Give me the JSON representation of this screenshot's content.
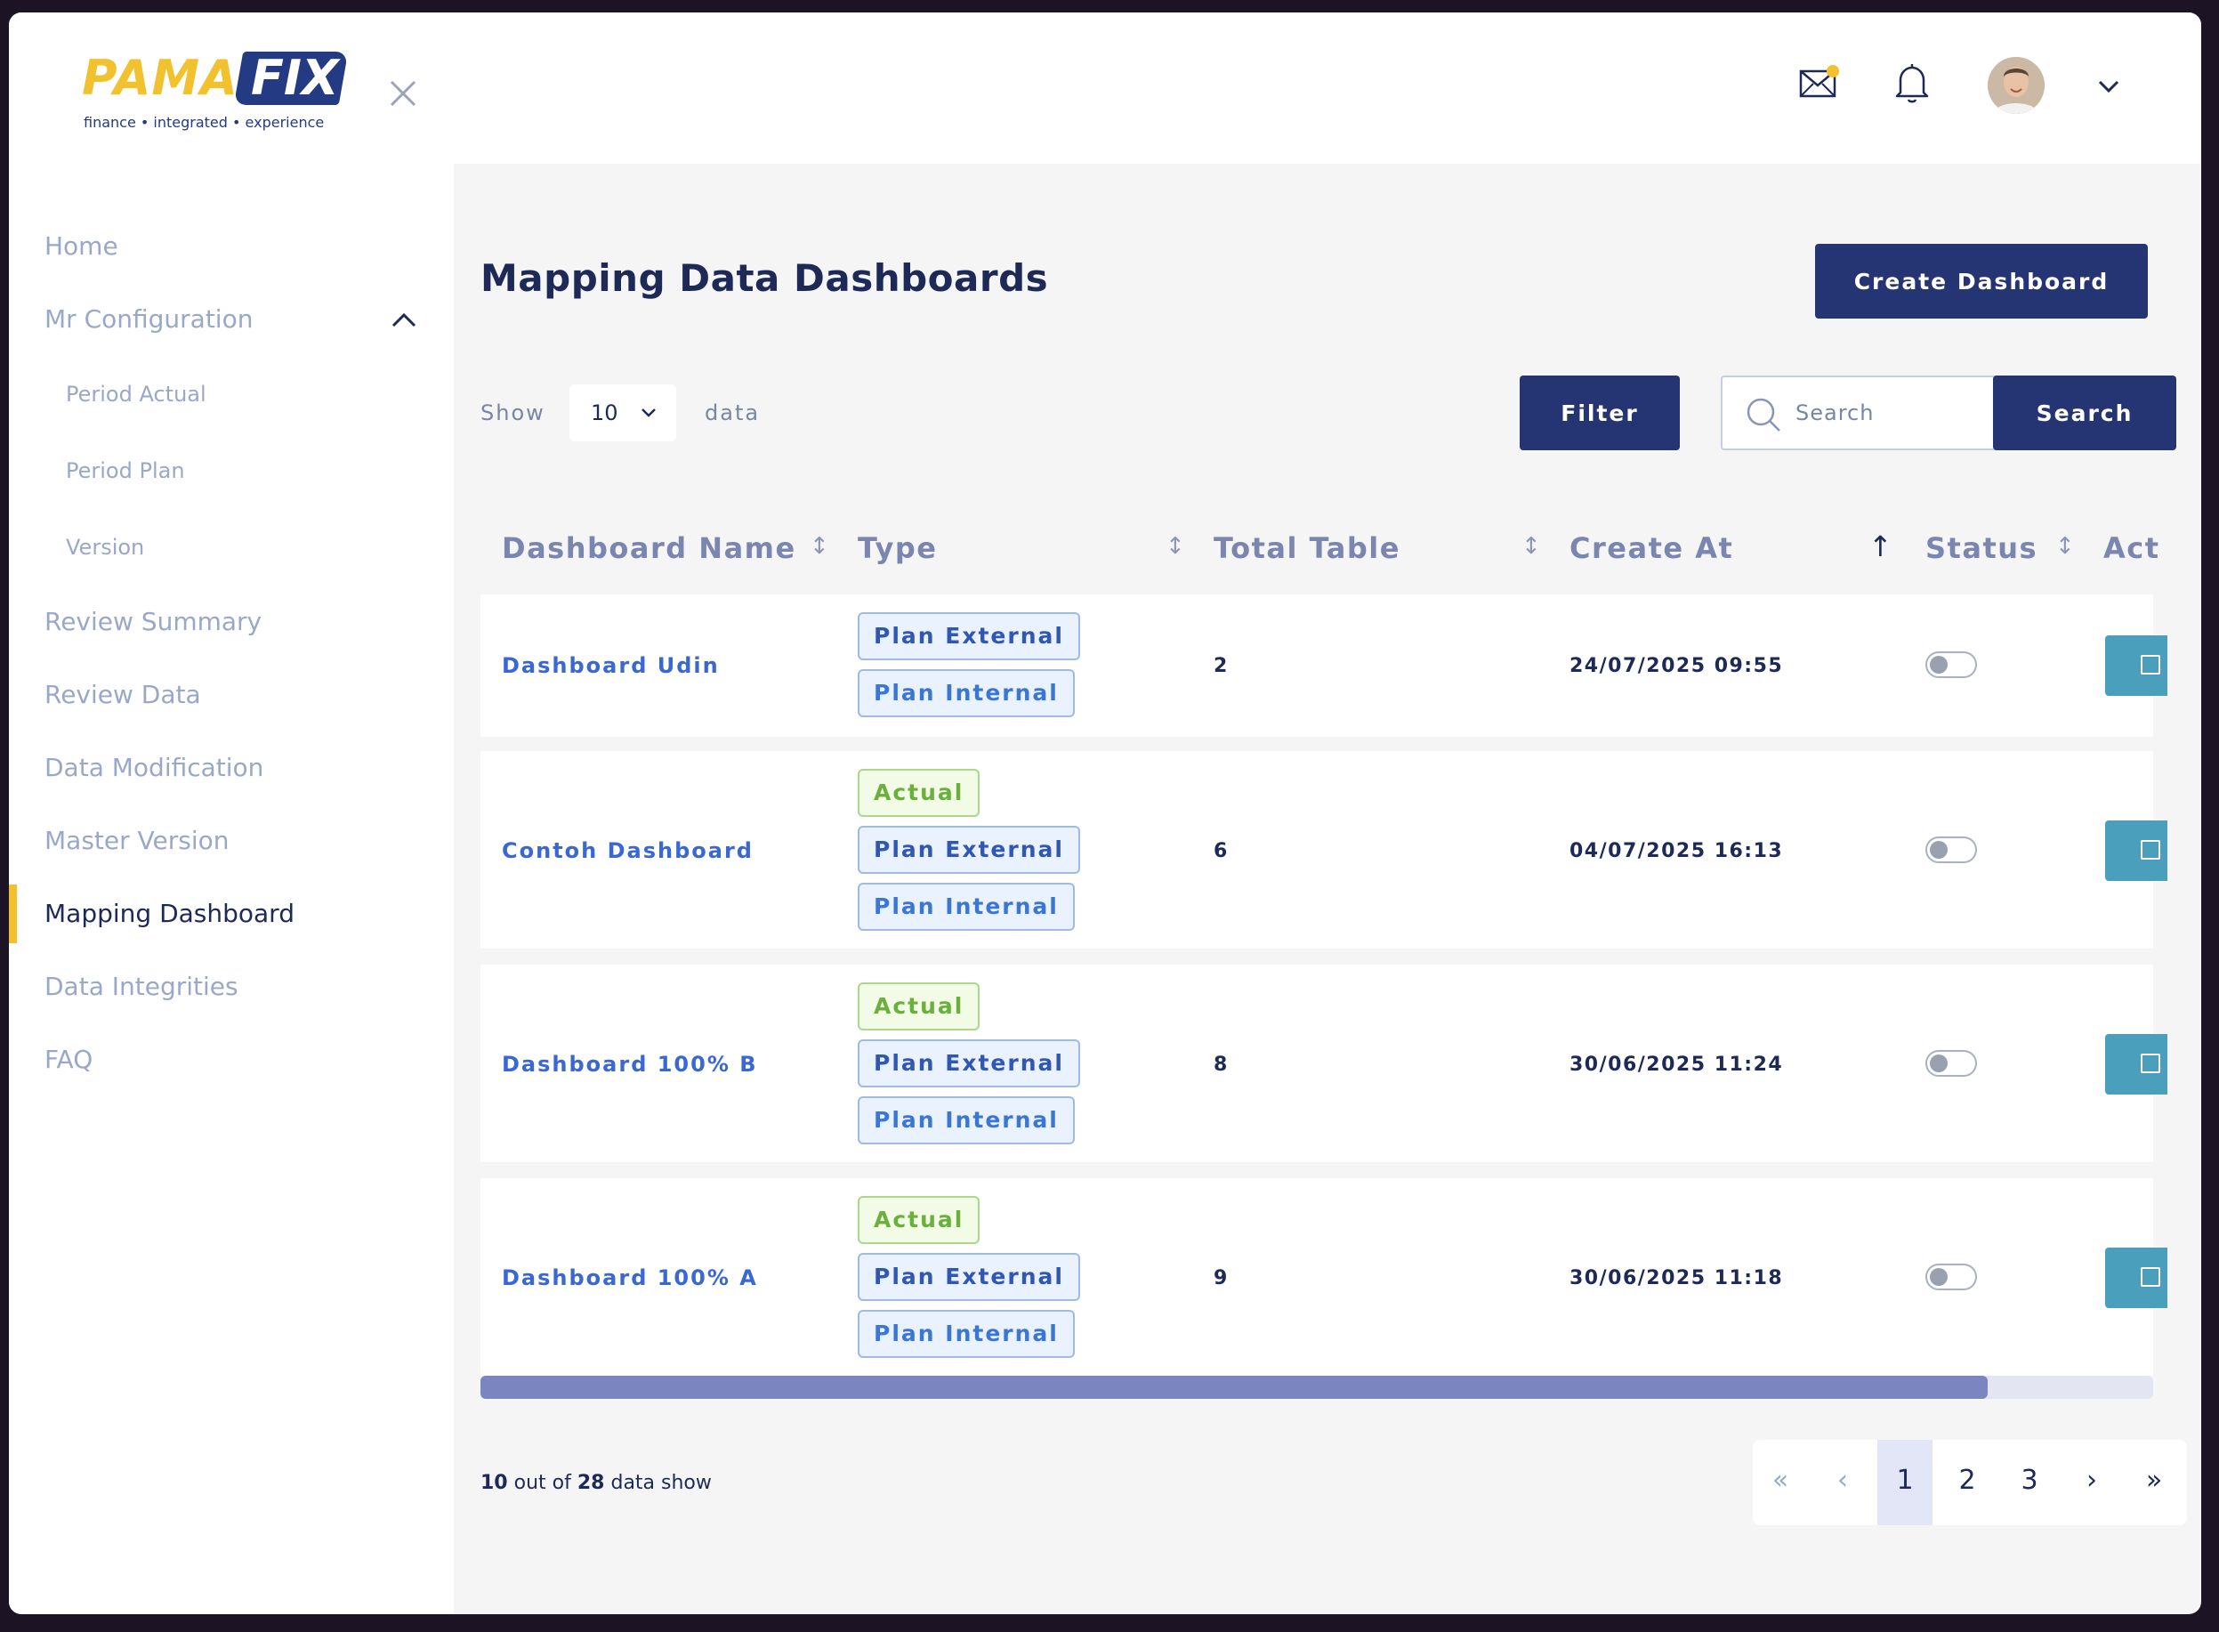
{
  "brand": {
    "name_left": "PAMA",
    "name_right": "FIX",
    "tagline": "finance  •  integrated  •  experience"
  },
  "sidebar": {
    "close_icon": "close-icon",
    "items": [
      {
        "label": "Home"
      },
      {
        "label": "Mr Configuration",
        "expanded": true,
        "children": [
          {
            "label": "Period Actual"
          },
          {
            "label": "Period Plan"
          },
          {
            "label": "Version"
          }
        ]
      },
      {
        "label": "Review Summary"
      },
      {
        "label": "Review Data"
      },
      {
        "label": "Data Modification"
      },
      {
        "label": "Master Version"
      },
      {
        "label": "Mapping Dashboard",
        "active": true
      },
      {
        "label": "Data Integrities"
      },
      {
        "label": "FAQ"
      }
    ]
  },
  "header": {
    "icons": [
      "mail-icon",
      "bell-icon",
      "avatar",
      "chevron-down-icon"
    ],
    "accent_color": "#f2c12e"
  },
  "page": {
    "title": "Mapping Data Dashboards",
    "create_button": "Create Dashboard",
    "show_label": "Show",
    "show_value": "10",
    "data_label": "data",
    "filter_button": "Filter",
    "search_placeholder": "Search",
    "search_button": "Search"
  },
  "table": {
    "columns": [
      "Dashboard Name",
      "Type",
      "Total Table",
      "Create At",
      "Status",
      "Act"
    ],
    "sort_active_column": "Create At",
    "rows": [
      {
        "name": "Dashboard Udin",
        "types": [
          "Plan External",
          "Plan Internal"
        ],
        "total": "2",
        "created": "24/07/2025 09:55",
        "status": false
      },
      {
        "name": "Contoh Dashboard",
        "types": [
          "Actual",
          "Plan External",
          "Plan Internal"
        ],
        "total": "6",
        "created": "04/07/2025 16:13",
        "status": false
      },
      {
        "name": "Dashboard 100% B",
        "types": [
          "Actual",
          "Plan External",
          "Plan Internal"
        ],
        "total": "8",
        "created": "30/06/2025 11:24",
        "status": false
      },
      {
        "name": "Dashboard 100% A",
        "types": [
          "Actual",
          "Plan External",
          "Plan Internal"
        ],
        "total": "9",
        "created": "30/06/2025 11:18",
        "status": false
      }
    ]
  },
  "footer": {
    "shown": "10",
    "out_of": "out of",
    "total": "28",
    "suffix": "data show",
    "pagination": {
      "first": "«",
      "prev": "‹",
      "pages": [
        "1",
        "2",
        "3"
      ],
      "current": "1",
      "next": "›",
      "last": "»"
    }
  },
  "colors": {
    "primary": "#253573",
    "link": "#3a67d6",
    "action": "#4a9fbd",
    "actual_badge": "#6bb03a",
    "plan_badge": "#2f57b3"
  }
}
